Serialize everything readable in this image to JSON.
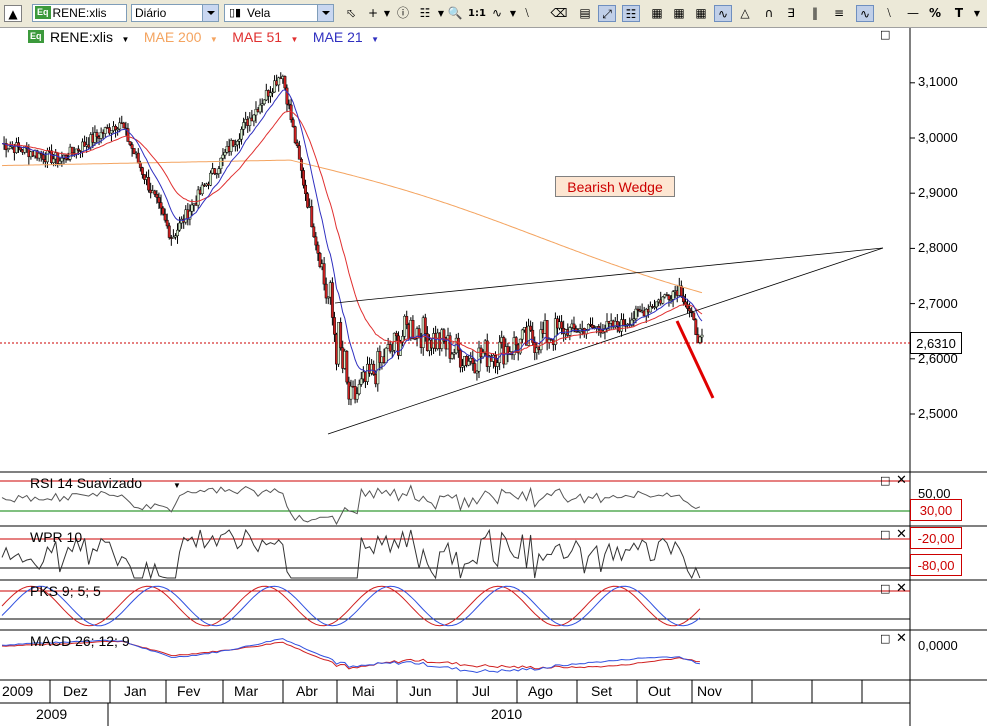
{
  "toolbar": {
    "symbol_badge": "Eq",
    "symbol_value": "RENE:xlis",
    "period_value": "Diário",
    "chart_style_value": "Vela",
    "zoom_label": "1:1",
    "percent_label": "%",
    "text_tool_label": "T"
  },
  "price_panel": {
    "symbol_badge": "Eq",
    "symbol_label": "RENE:xlis",
    "overlays": [
      {
        "label": "MAE 200",
        "color": "#f4a460"
      },
      {
        "label": "MAE 51",
        "color": "#e03030"
      },
      {
        "label": "MAE 21",
        "color": "#3030c0"
      }
    ],
    "annotation": "Bearish Wedge",
    "last_price": "2,6310",
    "y_ticks": [
      "3,1000",
      "3,0000",
      "2,9000",
      "2,8000",
      "2,7000",
      "2,6000",
      "2,5000"
    ]
  },
  "indicators": [
    {
      "label": "RSI 14 Suavizado",
      "levels": [
        "50,00",
        "30,00"
      ]
    },
    {
      "label": "WPR 10",
      "levels": [
        "-20,00",
        "-80,00"
      ]
    },
    {
      "label": "PKS 9; 5; 5",
      "levels": []
    },
    {
      "label": "MACD 26; 12; 9",
      "levels": [
        "0,0000"
      ]
    }
  ],
  "x_axis": {
    "months": [
      "2009",
      "Dez",
      "Jan",
      "Fev",
      "Mar",
      "Abr",
      "Mai",
      "Jun",
      "Jul",
      "Ago",
      "Set",
      "Out",
      "Nov"
    ],
    "years": [
      "2009",
      "2010"
    ]
  },
  "colors": {
    "mae200": "#f4a460",
    "mae51": "#e03030",
    "mae21": "#3030c0",
    "last_price_line": "#cc0000",
    "arrow": "#e00000",
    "candle_up": "#d8f0d0",
    "candle_down": "#cc2020"
  },
  "chart_data": {
    "type": "candlestick",
    "symbol": "RENE:xlis",
    "period": "Diário",
    "y_range": [
      2.45,
      3.16
    ],
    "last": 2.631,
    "key_prices": [
      {
        "date": "2009-11",
        "value": 2.99
      },
      {
        "date": "2009-12",
        "value": 2.96
      },
      {
        "date": "2010-01",
        "value": 3.03
      },
      {
        "date": "2010-02",
        "value": 2.82
      },
      {
        "date": "2010-03",
        "value": 2.99
      },
      {
        "date": "2010-04-early",
        "value": 3.12
      },
      {
        "date": "2010-04-mid",
        "value": 2.95
      },
      {
        "date": "2010-05",
        "value": 2.52
      },
      {
        "date": "2010-06",
        "value": 2.66
      },
      {
        "date": "2010-07",
        "value": 2.6
      },
      {
        "date": "2010-08",
        "value": 2.65
      },
      {
        "date": "2010-09",
        "value": 2.66
      },
      {
        "date": "2010-10",
        "value": 2.73
      },
      {
        "date": "2010-11",
        "value": 2.631
      }
    ],
    "moving_averages": [
      "MAE 200",
      "MAE 51",
      "MAE 21"
    ],
    "indicators": [
      "RSI 14 Suavizado",
      "WPR 10",
      "PKS 9; 5; 5",
      "MACD 26; 12; 9"
    ]
  }
}
